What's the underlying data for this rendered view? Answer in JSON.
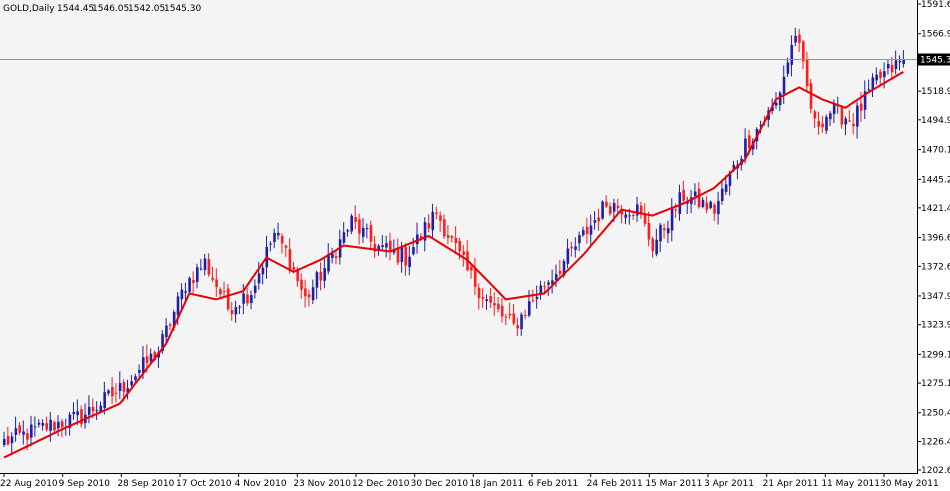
{
  "chart_data": {
    "type": "candlestick",
    "symbol": "GOLD,Daily",
    "ohlc": {
      "open": "1544.45",
      "high": "1546.05",
      "low": "1542.05",
      "close": "1545.30"
    },
    "current_price": 1545.3,
    "current_price_label": "1545.30",
    "ylim": [
      1202.6,
      1591.65
    ],
    "y_ticks": [
      "1591.65",
      "1566.90",
      "1543.15",
      "1518.90",
      "1494.95",
      "1470.15",
      "1445.20",
      "1421.45",
      "1396.65",
      "1372.65",
      "1347.90",
      "1323.90",
      "1299.15",
      "1275.15",
      "1250.40",
      "1226.40",
      "1202.60"
    ],
    "x_ticks": [
      "22 Aug 2010",
      "9 Sep 2010",
      "28 Sep 2010",
      "17 Oct 2010",
      "4 Nov 2010",
      "23 Nov 2010",
      "12 Dec 2010",
      "30 Dec 2010",
      "18 Jan 2011",
      "6 Feb 2011",
      "24 Feb 2011",
      "15 Mar 2011",
      "3 Apr 2011",
      "21 Apr 2011",
      "11 May 2011",
      "30 May 2011"
    ],
    "price_keypoints": [
      {
        "t": 0,
        "p": 1226
      },
      {
        "t": 10,
        "p": 1238
      },
      {
        "t": 20,
        "p": 1247
      },
      {
        "t": 30,
        "p": 1270
      },
      {
        "t": 40,
        "p": 1302
      },
      {
        "t": 47,
        "p": 1358
      },
      {
        "t": 52,
        "p": 1376
      },
      {
        "t": 58,
        "p": 1338
      },
      {
        "t": 64,
        "p": 1352
      },
      {
        "t": 70,
        "p": 1400
      },
      {
        "t": 73,
        "p": 1385
      },
      {
        "t": 78,
        "p": 1345
      },
      {
        "t": 84,
        "p": 1376
      },
      {
        "t": 90,
        "p": 1410
      },
      {
        "t": 96,
        "p": 1390
      },
      {
        "t": 104,
        "p": 1380
      },
      {
        "t": 112,
        "p": 1418
      },
      {
        "t": 120,
        "p": 1368
      },
      {
        "t": 126,
        "p": 1340
      },
      {
        "t": 132,
        "p": 1322
      },
      {
        "t": 138,
        "p": 1350
      },
      {
        "t": 146,
        "p": 1380
      },
      {
        "t": 156,
        "p": 1425
      },
      {
        "t": 164,
        "p": 1420
      },
      {
        "t": 168,
        "p": 1390
      },
      {
        "t": 176,
        "p": 1432
      },
      {
        "t": 184,
        "p": 1420
      },
      {
        "t": 192,
        "p": 1475
      },
      {
        "t": 200,
        "p": 1508
      },
      {
        "t": 205,
        "p": 1568
      },
      {
        "t": 210,
        "p": 1490
      },
      {
        "t": 214,
        "p": 1502
      },
      {
        "t": 220,
        "p": 1495
      },
      {
        "t": 226,
        "p": 1528
      },
      {
        "t": 233,
        "p": 1545
      }
    ],
    "ma_line_keypoints": [
      {
        "t": 0,
        "p": 1213
      },
      {
        "t": 16,
        "p": 1238
      },
      {
        "t": 30,
        "p": 1258
      },
      {
        "t": 42,
        "p": 1308
      },
      {
        "t": 48,
        "p": 1350
      },
      {
        "t": 55,
        "p": 1345
      },
      {
        "t": 62,
        "p": 1352
      },
      {
        "t": 68,
        "p": 1380
      },
      {
        "t": 75,
        "p": 1368
      },
      {
        "t": 82,
        "p": 1378
      },
      {
        "t": 88,
        "p": 1390
      },
      {
        "t": 100,
        "p": 1385
      },
      {
        "t": 110,
        "p": 1398
      },
      {
        "t": 120,
        "p": 1378
      },
      {
        "t": 130,
        "p": 1345
      },
      {
        "t": 140,
        "p": 1350
      },
      {
        "t": 150,
        "p": 1382
      },
      {
        "t": 160,
        "p": 1420
      },
      {
        "t": 168,
        "p": 1415
      },
      {
        "t": 176,
        "p": 1425
      },
      {
        "t": 184,
        "p": 1438
      },
      {
        "t": 192,
        "p": 1462
      },
      {
        "t": 200,
        "p": 1512
      },
      {
        "t": 206,
        "p": 1522
      },
      {
        "t": 212,
        "p": 1512
      },
      {
        "t": 218,
        "p": 1505
      },
      {
        "t": 224,
        "p": 1518
      },
      {
        "t": 233,
        "p": 1535
      }
    ],
    "bar_count": 234,
    "colors": {
      "background": "#f4f4f4",
      "page": "#ffffff",
      "bull": "#1f1fa8",
      "bear": "#ff1c1c",
      "ma": "#e80000",
      "axis": "#000000",
      "price_line": "#9090c0"
    }
  }
}
